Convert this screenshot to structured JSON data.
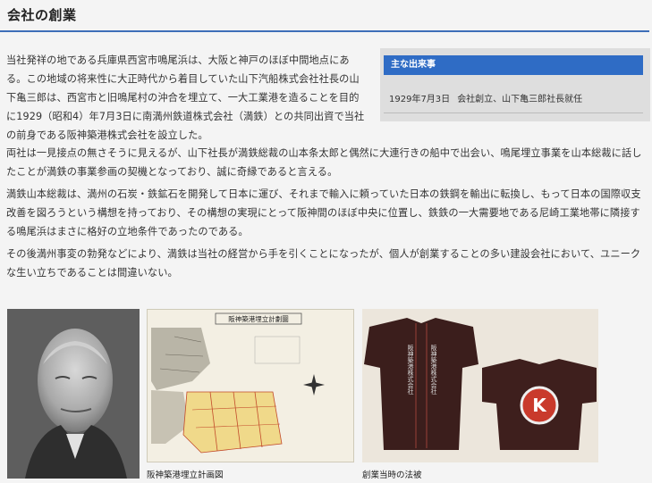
{
  "page": {
    "title": "会社の創業"
  },
  "body": {
    "paragraph1": "当社発祥の地である兵庫県西宮市鳴尾浜は、大阪と神戸のほぼ中間地点にある。この地域の将来性に大正時代から着目していた山下汽船株式会社社長の山下亀三郎は、西宮市と旧鳴尾村の沖合を埋立て、一大工業港を造ることを目的に1929（昭和4）年7月3日に南満州鉄道株式会社（満鉄）との共同出資で当社の前身である阪神築港株式会社を設立した。",
    "paragraph2": "両社は一見接点の無さそうに見えるが、山下社長が満鉄総裁の山本条太郎と偶然に大連行きの船中で出会い、鳴尾埋立事業を山本総裁に話したことが満鉄の事業参画の契機となっており、誠に奇縁であると言える。",
    "paragraph3": "満鉄山本総裁は、満州の石炭・鉄鉱石を開発して日本に運び、それまで輸入に頼っていた日本の鉄鋼を輸出に転換し、もって日本の国際収支改善を図ろうという構想を持っており、その構想の実現にとって阪神間のほぼ中央に位置し、鉄鉄の一大需要地である尼崎工業地帯に隣接する鳴尾浜はまさに格好の立地条件であったのである。",
    "paragraph4": "その後満州事変の勃発などにより、満鉄は当社の経営から手を引くことになったが、個人が創業することの多い建設会社において、ユニークな生い立ちであることは間違いない。"
  },
  "events": {
    "heading": "主な出来事",
    "items": [
      {
        "date": "1929年7月3日",
        "text": "会社創立、山下亀三郎社長就任"
      }
    ]
  },
  "images": {
    "map_title": "阪神築港埋立計劃圖",
    "caption_map": "阪神築港埋立計画図",
    "caption_coat": "創業当時の法被",
    "coat_text": "阪神築港株式会社",
    "coat_emblem": "K"
  }
}
